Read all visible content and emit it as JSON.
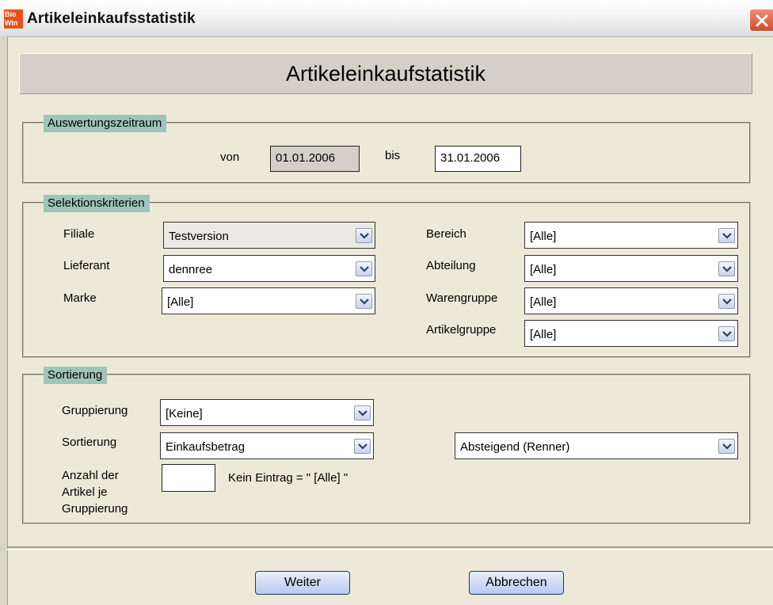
{
  "window": {
    "title": "Artikeleinkaufsstatistik",
    "logo_text": "Bio Win"
  },
  "header": {
    "title": "Artikeleinkaufstatistik"
  },
  "period": {
    "legend": "Auswertungszeitraum",
    "from_label": "von",
    "from_value": "01.01.2006",
    "to_label": "bis",
    "to_value": "31.01.2006"
  },
  "selection": {
    "legend": "Selektionskriterien",
    "filiale": {
      "label": "Filiale",
      "value": "Testversion"
    },
    "lieferant": {
      "label": "Lieferant",
      "value": "dennree"
    },
    "marke": {
      "label": "Marke",
      "value": "[Alle]"
    },
    "bereich": {
      "label": "Bereich",
      "value": "[Alle]"
    },
    "abteilung": {
      "label": "Abteilung",
      "value": "[Alle]"
    },
    "warengruppe": {
      "label": "Warengruppe",
      "value": "[Alle]"
    },
    "artikelgruppe": {
      "label": "Artikelgruppe",
      "value": "[Alle]"
    }
  },
  "sorting": {
    "legend": "Sortierung",
    "gruppierung": {
      "label": "Gruppierung",
      "value": "[Keine]"
    },
    "sortierung": {
      "label": "Sortierung",
      "value": "Einkaufsbetrag"
    },
    "order": {
      "value": "Absteigend (Renner)"
    },
    "anzahl": {
      "label_line1": "Anzahl der",
      "label_line2": "Artikel je",
      "label_line3": "Gruppierung",
      "value": "",
      "hint": "Kein Eintrag = \" [Alle] \""
    }
  },
  "buttons": {
    "next": "Weiter",
    "cancel": "Abbrechen"
  },
  "colors": {
    "legend_bg": "#9fc5b8",
    "window_bg": "#ece9d8",
    "close_red": "#d44a2c"
  }
}
